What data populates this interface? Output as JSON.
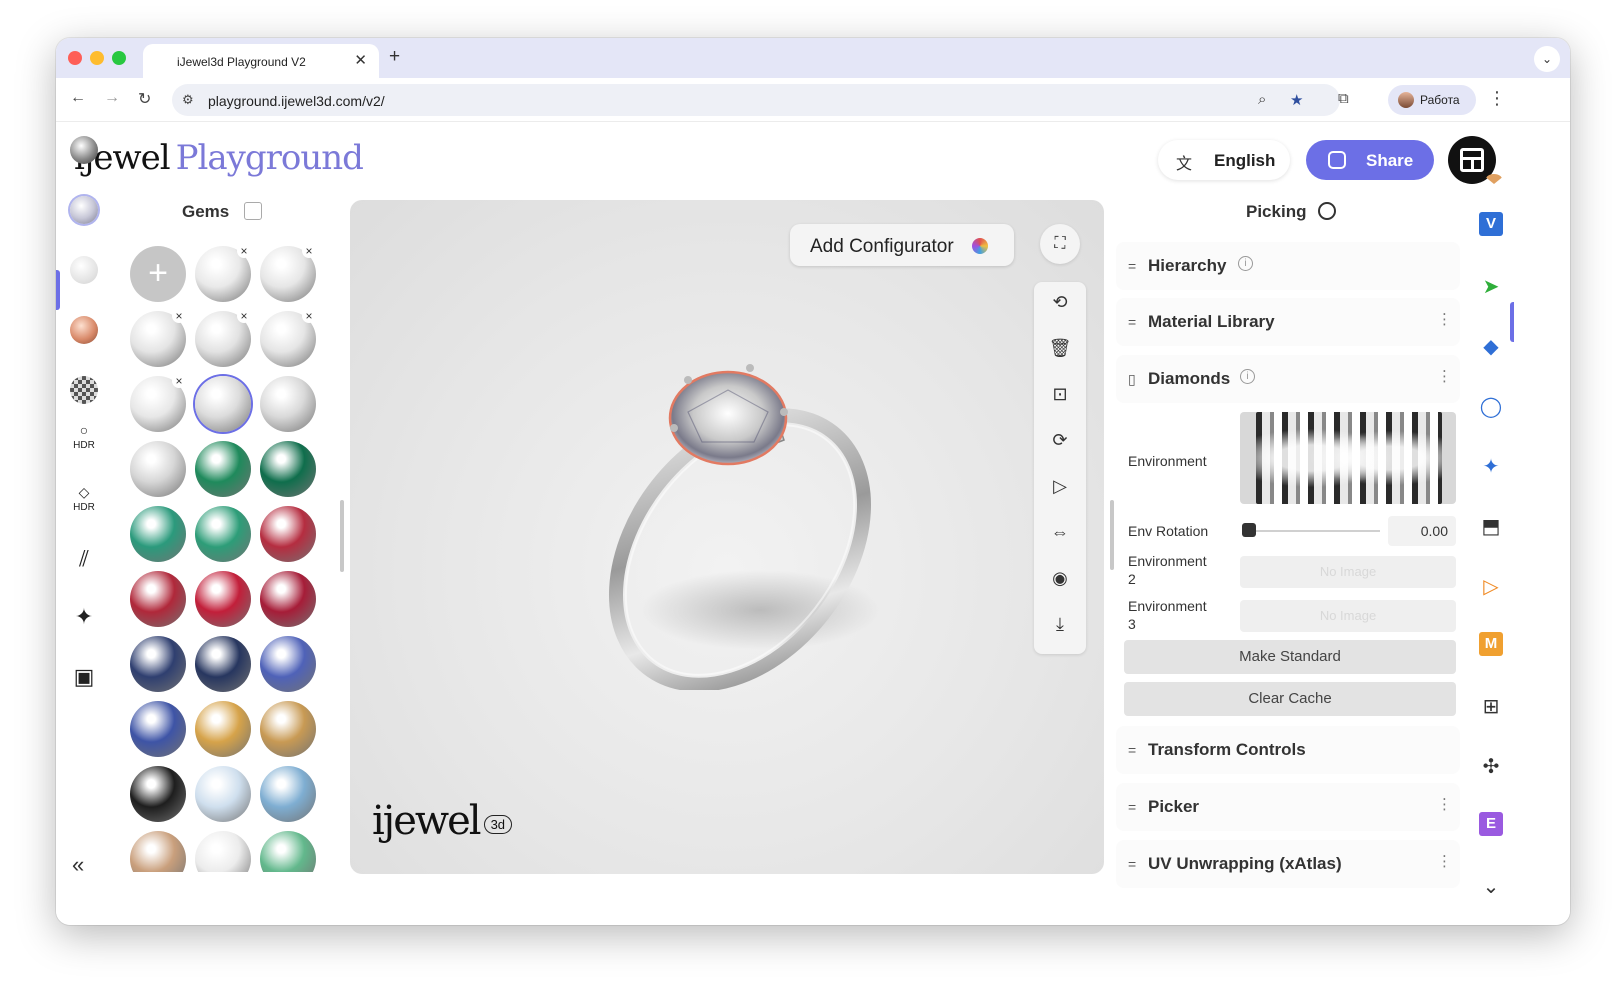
{
  "browser": {
    "tab_title": "iJewel3d Playground V2",
    "tab_close": "✕",
    "new_tab": "+",
    "url": "playground.ijewel3d.com/v2/",
    "profile_name": "Работа"
  },
  "header": {
    "logo_brand": "ijewel",
    "logo_product": "Playground",
    "language_label": "English",
    "share_label": "Share"
  },
  "left_rail": {
    "items": [
      {
        "name": "metal-material",
        "label": ""
      },
      {
        "name": "gem-material",
        "label": ""
      },
      {
        "name": "pearl-material",
        "label": ""
      },
      {
        "name": "rose-material",
        "label": ""
      },
      {
        "name": "pattern-material",
        "label": ""
      },
      {
        "name": "hdr-environment",
        "label": "HDR"
      },
      {
        "name": "gem-hdr-environment",
        "label": "HDR"
      },
      {
        "name": "background-pattern",
        "label": ""
      },
      {
        "name": "effects",
        "label": ""
      },
      {
        "name": "scene-image",
        "label": ""
      }
    ]
  },
  "gems_panel": {
    "title": "Gems",
    "gems": [
      {
        "type": "add",
        "color": "#c6c6c6",
        "removable": false,
        "selected": false
      },
      {
        "type": "gem",
        "color": "#e9e9e9",
        "removable": true,
        "selected": false
      },
      {
        "type": "gem",
        "color": "#e6e6e6",
        "removable": true,
        "selected": false
      },
      {
        "type": "gem",
        "color": "#e4e4e4",
        "removable": true,
        "selected": false
      },
      {
        "type": "gem",
        "color": "#e2e2e2",
        "removable": true,
        "selected": false
      },
      {
        "type": "gem",
        "color": "#e5e5e5",
        "removable": true,
        "selected": false
      },
      {
        "type": "gem",
        "color": "#e7e7e7",
        "removable": true,
        "selected": false
      },
      {
        "type": "gem",
        "color": "#dcdcdc",
        "removable": false,
        "selected": true
      },
      {
        "type": "gem",
        "color": "#d9d9d9",
        "removable": false,
        "selected": false
      },
      {
        "type": "gem",
        "color": "#d6d6d6",
        "removable": false,
        "selected": false
      },
      {
        "type": "gem",
        "color": "#1f8a5c",
        "removable": false,
        "selected": false
      },
      {
        "type": "gem",
        "color": "#0f6e4c",
        "removable": false,
        "selected": false
      },
      {
        "type": "gem",
        "color": "#2b9a7c",
        "removable": false,
        "selected": false
      },
      {
        "type": "gem",
        "color": "#2d9d78",
        "removable": false,
        "selected": false
      },
      {
        "type": "gem",
        "color": "#b52d40",
        "removable": false,
        "selected": false
      },
      {
        "type": "gem",
        "color": "#b0283a",
        "removable": false,
        "selected": false
      },
      {
        "type": "gem",
        "color": "#c21f3a",
        "removable": false,
        "selected": false
      },
      {
        "type": "gem",
        "color": "#a61d38",
        "removable": false,
        "selected": false
      },
      {
        "type": "gem",
        "color": "#2f3f70",
        "removable": false,
        "selected": false
      },
      {
        "type": "gem",
        "color": "#27365f",
        "removable": false,
        "selected": false
      },
      {
        "type": "gem",
        "color": "#4f62b8",
        "removable": false,
        "selected": false
      },
      {
        "type": "gem",
        "color": "#3e54a6",
        "removable": false,
        "selected": false
      },
      {
        "type": "gem",
        "color": "#d6a34a",
        "removable": false,
        "selected": false
      },
      {
        "type": "gem",
        "color": "#c89a54",
        "removable": false,
        "selected": false
      },
      {
        "type": "gem",
        "color": "#1e1e1e",
        "removable": false,
        "selected": false
      },
      {
        "type": "gem",
        "color": "#cfdfee",
        "removable": false,
        "selected": false
      },
      {
        "type": "gem",
        "color": "#7faed2",
        "removable": false,
        "selected": false
      },
      {
        "type": "gem",
        "color": "#c99f7c",
        "removable": false,
        "selected": false
      },
      {
        "type": "gem",
        "color": "#ececec",
        "removable": false,
        "selected": false
      },
      {
        "type": "gem",
        "color": "#62b88c",
        "removable": false,
        "selected": false
      }
    ]
  },
  "viewport": {
    "add_configurator_label": "Add Configurator",
    "logo_brand": "ijewel",
    "logo_badge": "3d",
    "tools": [
      {
        "name": "rotate-view",
        "glyph": "⟲"
      },
      {
        "name": "delete",
        "glyph": "🗑"
      },
      {
        "name": "focus",
        "glyph": "⊡"
      },
      {
        "name": "auto-rotate",
        "glyph": "⟳"
      },
      {
        "name": "play",
        "glyph": "▷"
      },
      {
        "name": "flip",
        "glyph": "⇔"
      },
      {
        "name": "camera",
        "glyph": "◉"
      },
      {
        "name": "download",
        "glyph": "⤓"
      }
    ]
  },
  "right_panel": {
    "title": "Picking",
    "sections": [
      {
        "name": "hierarchy",
        "label": "Hierarchy",
        "info": true,
        "more": false
      },
      {
        "name": "material-library",
        "label": "Material Library",
        "info": false,
        "more": true
      },
      {
        "name": "diamonds",
        "label": "Diamonds",
        "info": true,
        "more": true
      },
      {
        "name": "transform-controls",
        "label": "Transform Controls",
        "info": false,
        "more": false
      },
      {
        "name": "picker",
        "label": "Picker",
        "info": false,
        "more": true
      },
      {
        "name": "uv-unwrapping",
        "label": "UV Unwrapping (xAtlas)",
        "info": false,
        "more": true
      }
    ],
    "diamonds": {
      "environment_label": "Environment",
      "env_rotation_label": "Env Rotation",
      "env_rotation_value": "0.00",
      "environment2_label": "Environment\n2",
      "environment3_label": "Environment\n3",
      "no_image_label": "No Image",
      "make_standard_label": "Make Standard",
      "clear_cache_label": "Clear Cache"
    }
  },
  "right_rail": {
    "items": [
      {
        "name": "v-plugin",
        "glyph": "V",
        "color": "#2f6fd6"
      },
      {
        "name": "pointer-tool",
        "glyph": "➤",
        "color": "#2fae3a"
      },
      {
        "name": "shapes-tool",
        "glyph": "◆",
        "color": "#2f6fd6"
      },
      {
        "name": "ring-tool",
        "glyph": "◯",
        "color": "#2f6fd6"
      },
      {
        "name": "sparkle-tool",
        "glyph": "✦",
        "color": "#2f6fd6"
      },
      {
        "name": "export-tool",
        "glyph": "⬒",
        "color": "#333333"
      },
      {
        "name": "play-tool",
        "glyph": "▷",
        "color": "#f08a24"
      },
      {
        "name": "m-plugin",
        "glyph": "M",
        "color": "#f0a030"
      },
      {
        "name": "grid-tool",
        "glyph": "⊞",
        "color": "#333333"
      },
      {
        "name": "puzzle-tool",
        "glyph": "✣",
        "color": "#333333"
      },
      {
        "name": "e-plugin",
        "glyph": "E",
        "color": "#9a5ae0"
      },
      {
        "name": "more-chevron",
        "glyph": "⌄",
        "color": "#333333"
      }
    ]
  },
  "colors": {
    "accent": "#6c6fe6",
    "logo_accent": "#7b79d8"
  }
}
